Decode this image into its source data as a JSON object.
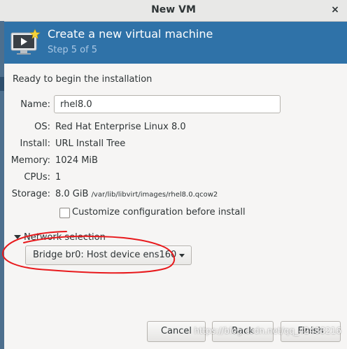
{
  "window": {
    "title": "New VM",
    "close_glyph": "×",
    "close_icon": "close-icon"
  },
  "banner": {
    "icon": "monitor-new-icon",
    "heading": "Create a new virtual machine",
    "step": "Step 5 of 5",
    "color": "#2f72a8"
  },
  "summary": {
    "ready_text": "Ready to begin the installation",
    "name_label": "Name:",
    "name_value": "rhel8.0",
    "os_label": "OS:",
    "os_value": "Red Hat Enterprise Linux 8.0",
    "install_label": "Install:",
    "install_value": "URL Install Tree",
    "memory_label": "Memory:",
    "memory_value": "1024 MiB",
    "cpus_label": "CPUs:",
    "cpus_value": "1",
    "storage_label": "Storage:",
    "storage_size": "8.0 GiB",
    "storage_path": "/var/lib/libvirt/images/rhel8.0.qcow2",
    "customize_label": "Customize configuration before install",
    "customize_checked": false
  },
  "network": {
    "expander_label": "Network selection",
    "selected": "Bridge br0: Host device ens160"
  },
  "buttons": {
    "cancel": "Cancel",
    "back": "Back",
    "finish": "Finish"
  },
  "watermark": "https://blog.csdn.net/qq_42488216"
}
